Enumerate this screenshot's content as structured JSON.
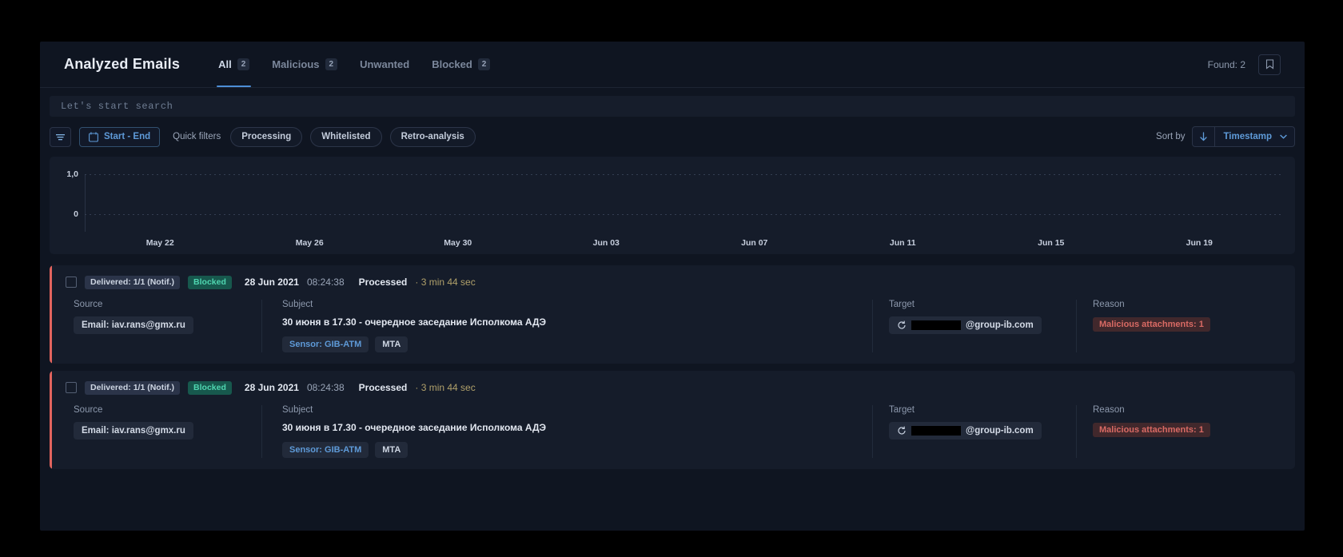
{
  "header": {
    "title": "Analyzed Emails",
    "tabs": [
      {
        "label": "All",
        "count": "2",
        "active": true
      },
      {
        "label": "Malicious",
        "count": "2",
        "active": false
      },
      {
        "label": "Unwanted",
        "count": "",
        "active": false
      },
      {
        "label": "Blocked",
        "count": "2",
        "active": false
      }
    ],
    "found_label": "Found: 2",
    "bookmark_icon": "bookmark-icon"
  },
  "search": {
    "placeholder": "Let's start search"
  },
  "filters": {
    "filter_icon": "filter-icon",
    "calendar_icon": "calendar-icon",
    "date_label": "Start - End",
    "quick_filters_label": "Quick filters",
    "chips": [
      "Processing",
      "Whitelisted",
      "Retro-analysis"
    ],
    "sort_by_label": "Sort by",
    "sort_direction_icon": "arrow-down-icon",
    "sort_field": "Timestamp",
    "chevron_icon": "chevron-down-icon"
  },
  "chart_data": {
    "type": "bar",
    "title": "",
    "xlabel": "",
    "ylabel": "",
    "categories": [
      "May 22",
      "May 26",
      "May 30",
      "Jun 03",
      "Jun 07",
      "Jun 11",
      "Jun 15",
      "Jun 19"
    ],
    "values": [
      0,
      0,
      0,
      0,
      0,
      0,
      0,
      0
    ],
    "ytick_labels": [
      "1,0",
      "0"
    ],
    "ylim": [
      0,
      1
    ],
    "grid": true,
    "legend": "none"
  },
  "emails": [
    {
      "delivered_badge": "Delivered: 1/1 (Notif.)",
      "status_badge": "Blocked",
      "date": "28 Jun 2021",
      "time": "08:24:38",
      "processed_label": "Processed",
      "duration": "· 3 min 44 sec",
      "source_title": "Source",
      "source_value": "Email: iav.rans@gmx.ru",
      "subject_title": "Subject",
      "subject_value": "30 июня в 17.30 - очередное заседание Исполкома АДЭ",
      "sensor_tag": "Sensor: GIB-ATM",
      "mta_tag": "MTA",
      "target_title": "Target",
      "target_value": "@group-ib.com",
      "reason_title": "Reason",
      "reason_value": "Malicious attachments: 1"
    },
    {
      "delivered_badge": "Delivered: 1/1 (Notif.)",
      "status_badge": "Blocked",
      "date": "28 Jun 2021",
      "time": "08:24:38",
      "processed_label": "Processed",
      "duration": "· 3 min 44 sec",
      "source_title": "Source",
      "source_value": "Email: iav.rans@gmx.ru",
      "subject_title": "Subject",
      "subject_value": "30 июня в 17.30 - очередное заседание Исполкома АДЭ",
      "sensor_tag": "Sensor: GIB-ATM",
      "mta_tag": "MTA",
      "target_title": "Target",
      "target_value": "@group-ib.com",
      "reason_title": "Reason",
      "reason_value": "Malicious attachments: 1"
    }
  ],
  "colors": {
    "accent_blue": "#5e9ad8",
    "status_green": "#4fd6b0",
    "danger_red": "#e2645e",
    "duration_yellow": "#b0a06a"
  }
}
